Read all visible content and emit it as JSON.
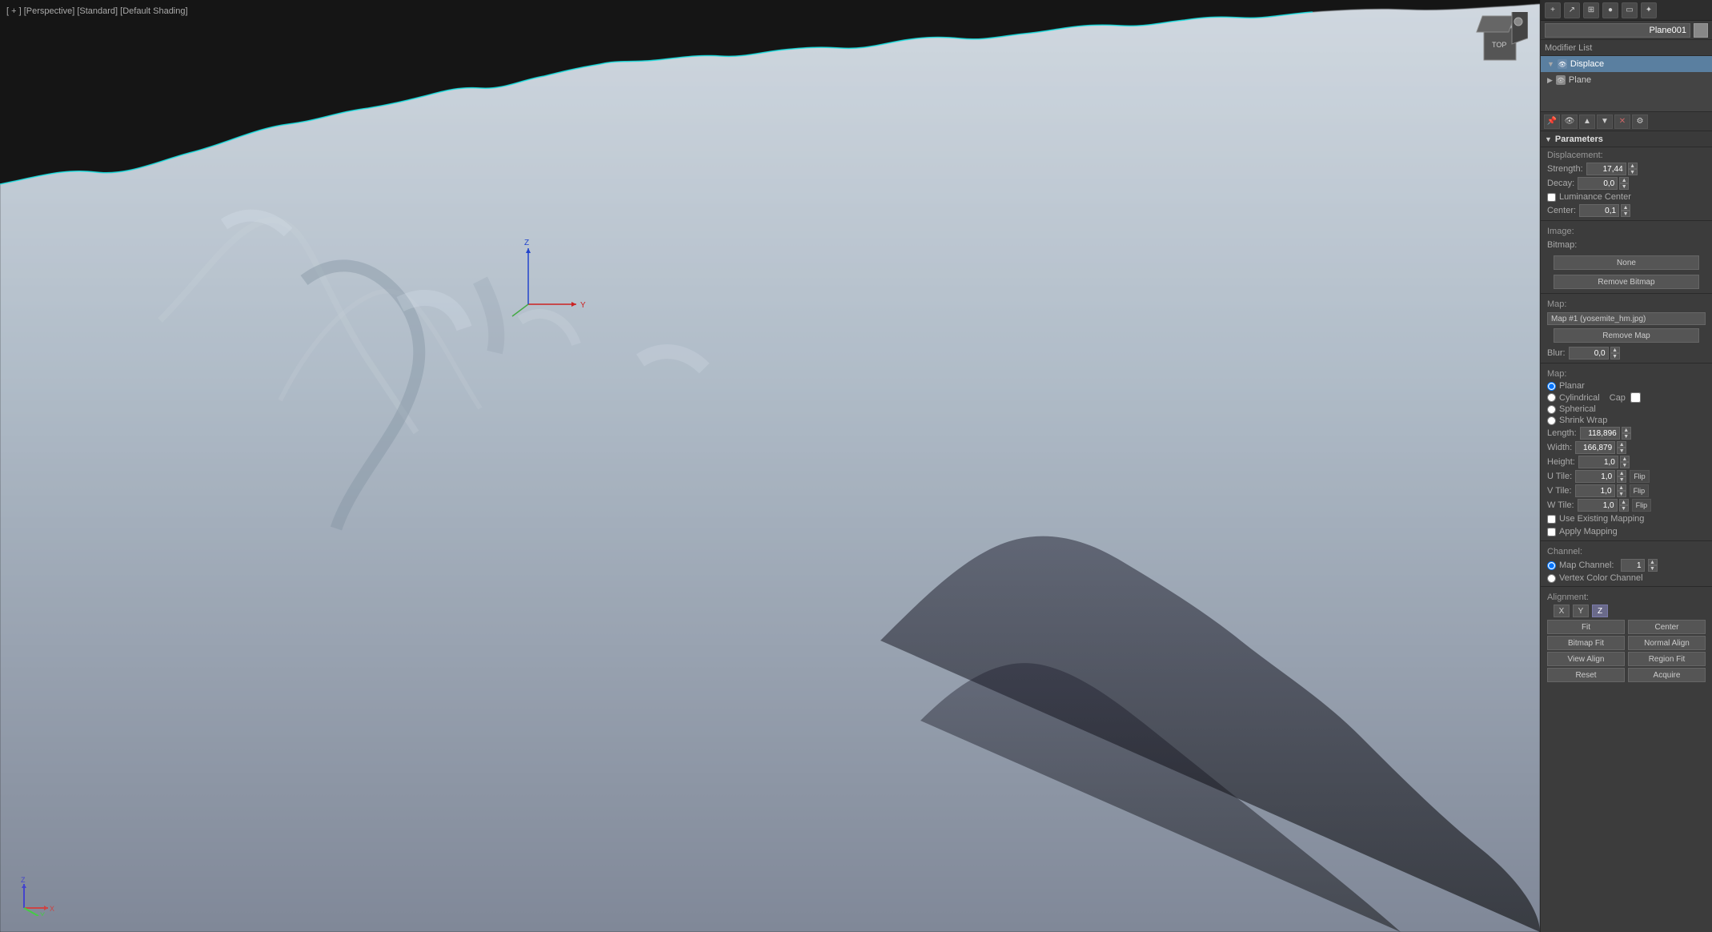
{
  "viewport": {
    "label": "[ + ] [Perspective] [Standard] [Default Shading]",
    "background_color": "#1a1a1a"
  },
  "toolbar": {
    "buttons": [
      "+",
      "↗",
      "⊞",
      "●",
      "⊡",
      "✦"
    ]
  },
  "object": {
    "name": "Plane001",
    "color": "#888888"
  },
  "modifier_list": {
    "label": "Modifier List",
    "items": [
      {
        "name": "Displace",
        "selected": true,
        "expanded": true
      },
      {
        "name": "Plane",
        "selected": false,
        "expanded": false
      }
    ]
  },
  "modifier_buttons": [
    "pin",
    "show",
    "move-up",
    "move-down",
    "delete",
    "config"
  ],
  "parameters": {
    "section_label": "Parameters",
    "displacement": {
      "label": "Displacement:",
      "strength_label": "Strength:",
      "strength_value": "17,44",
      "decay_label": "Decay:",
      "decay_value": "0,0",
      "luminance_center_label": "Luminance Center",
      "center_label": "Center:",
      "center_value": "0,1"
    },
    "image": {
      "label": "Image:",
      "bitmap_label": "Bitmap:",
      "bitmap_none": "None",
      "remove_bitmap": "Remove Bitmap"
    },
    "map_top": {
      "label": "Map:",
      "map_name": "Map #1 (yosemite_hm.jpg)",
      "remove_map": "Remove Map",
      "blur_label": "Blur:",
      "blur_value": "0,0"
    },
    "map_bottom": {
      "label": "Map:",
      "planar_label": "Planar",
      "cylindrical_label": "Cylindrical",
      "cap_label": "Cap",
      "spherical_label": "Spherical",
      "shrink_wrap_label": "Shrink Wrap",
      "length_label": "Length:",
      "length_value": "118,896",
      "width_label": "Width:",
      "width_value": "166,879",
      "height_label": "Height:",
      "height_value": "1,0",
      "u_tile_label": "U Tile:",
      "u_tile_value": "1,0",
      "u_flip": "Flip",
      "v_tile_label": "V Tile:",
      "v_tile_value": "1,0",
      "v_flip": "Flip",
      "w_tile_label": "W Tile:",
      "w_tile_value": "1,0",
      "w_flip": "Flip",
      "use_existing_mapping": "Use Existing Mapping",
      "apply_mapping": "Apply Mapping"
    },
    "channel": {
      "label": "Channel:",
      "map_channel_label": "Map Channel:",
      "map_channel_value": "1",
      "vertex_color_channel": "Vertex Color Channel"
    },
    "alignment": {
      "label": "Alignment:",
      "x_label": "X",
      "y_label": "Y",
      "z_label": "Z",
      "z_active": true,
      "fit_btn": "Fit",
      "center_btn": "Center",
      "bitmap_fit_btn": "Bitmap Fit",
      "normal_align_btn": "Normal Align",
      "view_align_btn": "View Align",
      "region_fit_btn": "Region Fit",
      "reset_btn": "Reset",
      "acquire_btn": "Acquire"
    }
  }
}
